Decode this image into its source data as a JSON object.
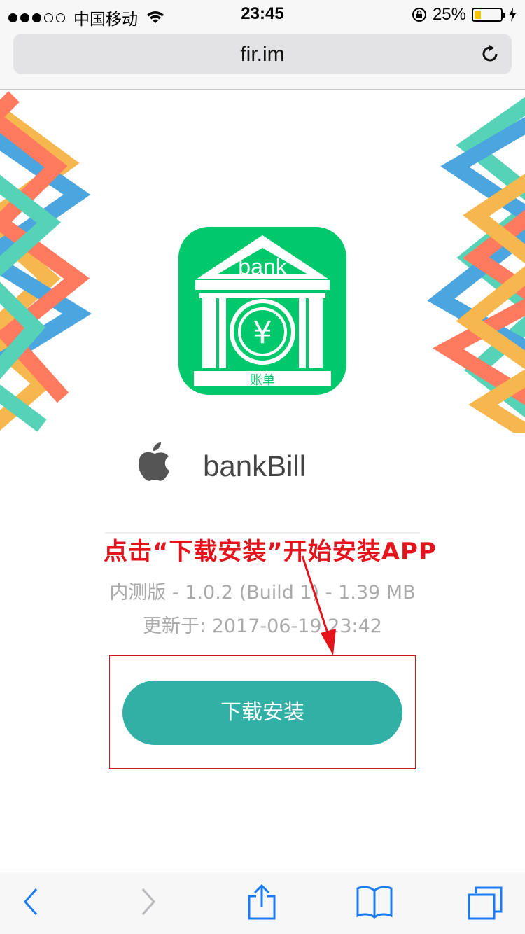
{
  "status_bar": {
    "carrier": "中国移动",
    "time": "23:45",
    "battery_percent": "25%",
    "battery_level": 0.25
  },
  "browser": {
    "url": "fir.im"
  },
  "app": {
    "icon_text": "bank",
    "icon_subtext": "账单",
    "name": "bankBill",
    "version_info": "内测版 - 1.0.2 (Build 1) - 1.39 MB",
    "updated_info": "更新于: 2017-06-19 23:42",
    "install_label": "下载安装"
  },
  "annotation": {
    "text": "点击“下载安装”开始安装APP"
  },
  "colors": {
    "accent": "#31b1a6",
    "icon_green": "#00c96b",
    "annotation_red": "#e3141c",
    "ios_blue": "#1a7cf5"
  }
}
